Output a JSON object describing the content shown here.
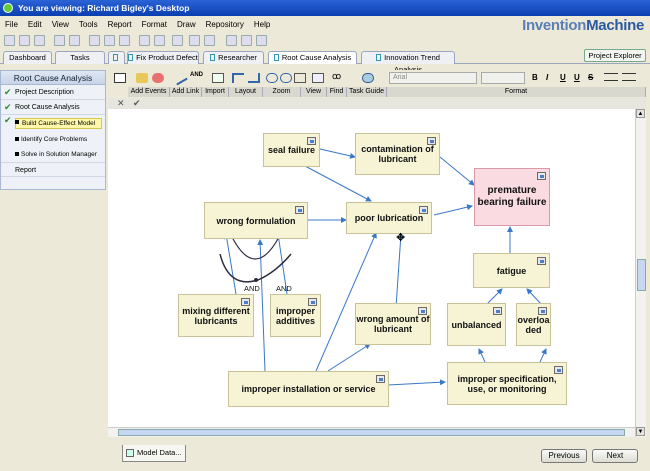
{
  "window": {
    "title": "You are viewing: Richard Bigley's Desktop"
  },
  "menu": [
    "File",
    "Edit",
    "View",
    "Tools",
    "Report",
    "Format",
    "Draw",
    "Repository",
    "Help"
  ],
  "brand": {
    "part1": "Invention",
    "part2": "Machine"
  },
  "tabs": [
    "Dashboard",
    "Tasks",
    "",
    "Fix Product Defect",
    "Researcher",
    "Root Cause Analysis",
    "Innovation Trend Analysis"
  ],
  "project_explorer": "Project Explorer",
  "left_panel": {
    "title": "Root Cause Analysis",
    "items": [
      {
        "label": "Project Description",
        "checked": true
      },
      {
        "label": "Root Cause Analysis",
        "checked": true
      }
    ],
    "subitems": [
      "Build Cause-Effect Model",
      "Identify Core Problems",
      "Solve in Solution Manager"
    ],
    "footer": "Report"
  },
  "ribbon": {
    "groups": [
      "Add Events",
      "Add Link",
      "Import",
      "Layout",
      "Zoom",
      "View",
      "Find",
      "Task Guide",
      "Format"
    ],
    "font": "Arial",
    "format_buttons": [
      "B",
      "I",
      "U",
      "U",
      "S"
    ]
  },
  "diagram": {
    "nodes": {
      "seal_failure": "seal failure",
      "contamination": "contamination of lubricant",
      "premature_bearing_failure": "premature bearing failure",
      "wrong_formulation": "wrong formulation",
      "poor_lubrication": "poor lubrication",
      "fatigue": "fatigue",
      "mixing": "mixing different lubricants",
      "improper_additives": "improper additives",
      "wrong_amount": "wrong amount of lubricant",
      "unbalanced": "unbalanced",
      "overloaded": "overloaded",
      "improper_installation": "improper installation or service",
      "improper_specification": "improper specification, use, or monitoring"
    },
    "and_labels": [
      "AND",
      "AND"
    ]
  },
  "bottom": {
    "tab": "Model Data...",
    "previous": "Previous",
    "next": "Next"
  }
}
